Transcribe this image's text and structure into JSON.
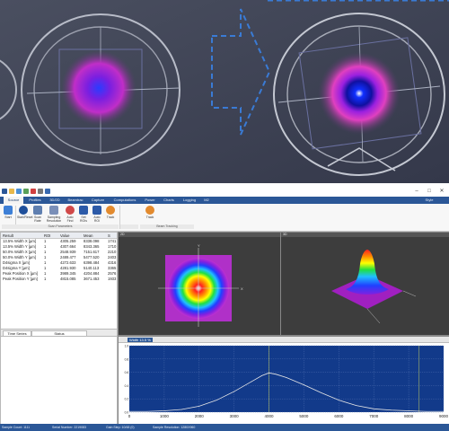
{
  "photo": {
    "description_colors": {
      "background": "#3c4050",
      "beam_outer": "#8a2be2",
      "beam_core": "#1e40ff"
    }
  },
  "app": {
    "titlebar": {
      "minimize": "–",
      "maximize": "□",
      "close": "✕",
      "style_label": "Style"
    },
    "tabs": [
      {
        "label": "Source",
        "active": true
      },
      {
        "label": "Profiles"
      },
      {
        "label": "3D/2D"
      },
      {
        "label": "Beamtrac"
      },
      {
        "label": "Capture"
      },
      {
        "label": "Computations"
      },
      {
        "label": "Power"
      },
      {
        "label": "Charts"
      },
      {
        "label": "Logging"
      },
      {
        "label": "M2"
      }
    ],
    "ribbon": {
      "buttons": [
        {
          "label": "Start",
          "icon": "play-icon"
        },
        {
          "label": "Start/Reset",
          "icon": "reset-icon"
        },
        {
          "label": "Scan Rate",
          "icon": "scan-icon"
        },
        {
          "label": "Sampling Resolution",
          "icon": "sampling-icon"
        },
        {
          "label": "Auto Find",
          "icon": "autofind-icon"
        },
        {
          "label": "Set ROIs",
          "icon": "roi-icon"
        },
        {
          "label": "Auto ROI",
          "icon": "auto-roi-icon"
        },
        {
          "label": "Track",
          "icon": "track-icon"
        },
        {
          "label": "Track",
          "icon": "track2-icon"
        }
      ],
      "groups": [
        "Scan Parameters",
        "",
        "Beam Tracking"
      ]
    },
    "results": {
      "headers": [
        "Result",
        "ROI",
        "Value",
        "Mean",
        "S"
      ],
      "rows": [
        [
          "13.5% Width X [µm]",
          "1",
          "4305.259",
          "8338.098",
          "1741"
        ],
        [
          "13.5% Width Y [µm]",
          "1",
          "4307.664",
          "8343.365",
          "1710"
        ],
        [
          "50.0% Width X [µm]",
          "1",
          "2548.939",
          "7151.617",
          "2210"
        ],
        [
          "50.0% Width Y [µm]",
          "1",
          "2489.477",
          "5477.520",
          "2403"
        ],
        [
          "D4sigma X [µm]",
          "1",
          "4272.633",
          "6398.484",
          "4316"
        ],
        [
          "D4sigma Y [µm]",
          "1",
          "4281.930",
          "5140.113",
          "3365"
        ],
        [
          "Peak Position X [µm]",
          "1",
          "3989.345",
          "4204.884",
          "2576"
        ],
        [
          "Peak Position Y [µm]",
          "1",
          "4815.085",
          "3671.453",
          "1933"
        ]
      ]
    },
    "status_tabs": [
      "Time Series",
      "Status"
    ],
    "view2d": {
      "title": "2D",
      "axis_y": "Y",
      "axis_x": "X"
    },
    "view3d": {
      "title": "3D"
    },
    "plot": {
      "header": "Width 13.5 %",
      "x_ticks": [
        "0",
        "1000",
        "2000",
        "3000",
        "4000",
        "5000",
        "6000",
        "7000",
        "8000",
        "9000"
      ],
      "y_ticks": [
        "1.0",
        "0.8",
        "0.6",
        "0.4",
        "0.2",
        "0.0"
      ]
    },
    "statusbar": {
      "items": [
        "Sample Count: 1111",
        "Serial Number: 2219083",
        "Gain Step: 10/48 (0)",
        "Sample Resolution: 1280X960"
      ]
    }
  },
  "chart_data": {
    "type": "line",
    "title": "",
    "xlabel": "",
    "ylabel": "",
    "xlim": [
      0,
      9000
    ],
    "ylim": [
      0,
      1
    ],
    "series": [
      {
        "x": [
          0,
          500,
          1000,
          1500,
          2000,
          2500,
          3000,
          3500,
          3800,
          4000,
          4200,
          4500,
          5000,
          5500,
          6000,
          6500,
          7000,
          7500,
          8000,
          8500,
          9000
        ],
        "values": [
          0.01,
          0.01,
          0.02,
          0.04,
          0.09,
          0.18,
          0.31,
          0.46,
          0.55,
          0.59,
          0.57,
          0.52,
          0.41,
          0.29,
          0.18,
          0.1,
          0.05,
          0.03,
          0.02,
          0.01,
          0.01
        ]
      }
    ],
    "grid": true
  }
}
